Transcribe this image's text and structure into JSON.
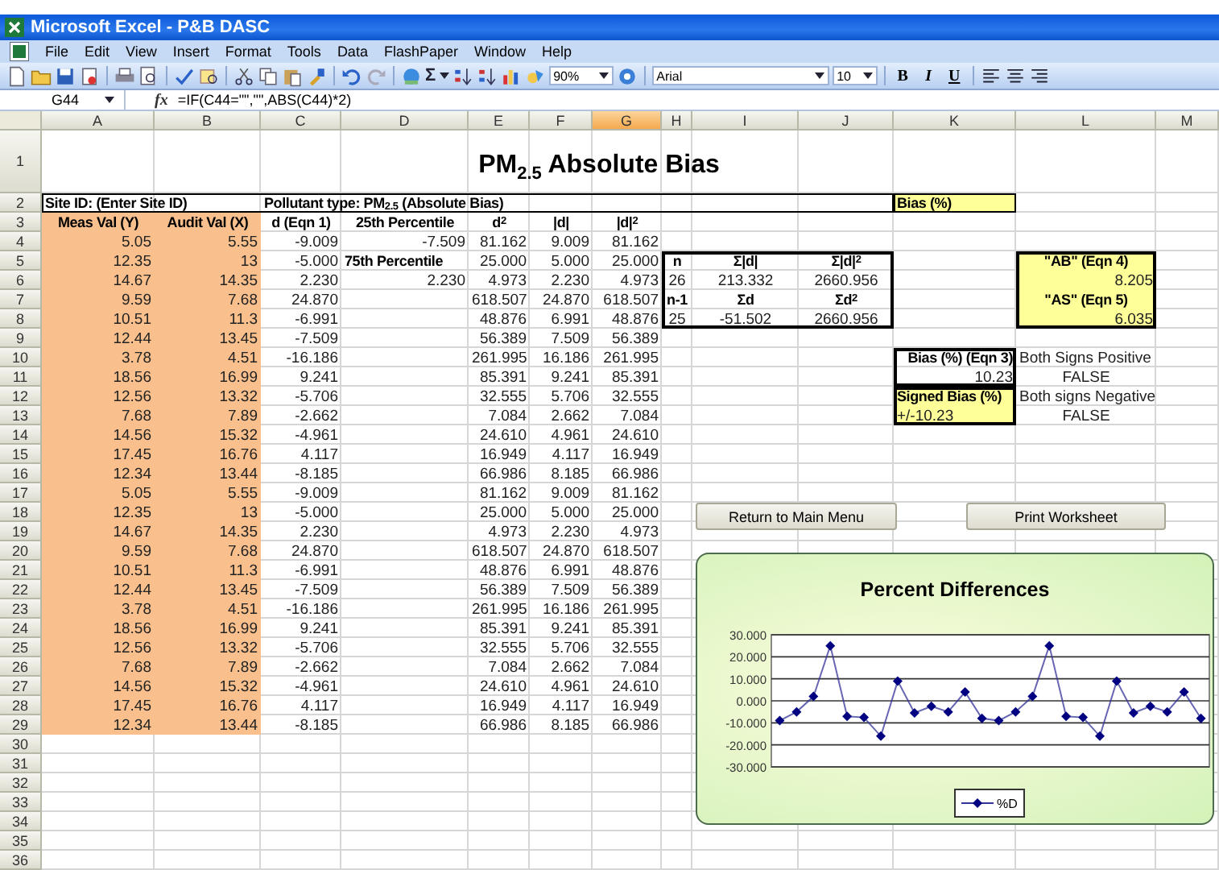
{
  "window": {
    "title": "Microsoft Excel - P&B DASC"
  },
  "menu": [
    "File",
    "Edit",
    "View",
    "Insert",
    "Format",
    "Tools",
    "Data",
    "FlashPaper",
    "Window",
    "Help"
  ],
  "toolbar": {
    "autosum": "Σ",
    "zoom": "90%",
    "font": "Arial",
    "font_size": "10",
    "format_buttons": [
      "B",
      "I",
      "U"
    ]
  },
  "formula_bar": {
    "name_box": "G44",
    "function_label": "fx",
    "formula": "=IF(C44=\"\",\"\",ABS(C44)*2)"
  },
  "columns": [
    {
      "label": "A",
      "selected": false
    },
    {
      "label": "B",
      "selected": false
    },
    {
      "label": "C",
      "selected": false
    },
    {
      "label": "D",
      "selected": false
    },
    {
      "label": "E",
      "selected": false
    },
    {
      "label": "F",
      "selected": false
    },
    {
      "label": "G",
      "selected": true
    },
    {
      "label": "H",
      "selected": false
    },
    {
      "label": "I",
      "selected": false
    },
    {
      "label": "J",
      "selected": false
    },
    {
      "label": "K",
      "selected": false
    },
    {
      "label": "L",
      "selected": false
    },
    {
      "label": "M",
      "selected": false
    }
  ],
  "rows": [
    {
      "number": "1",
      "cells": {
        "A": "PM$_{2.5}$ Absolute Bias"
      }
    },
    {
      "number": "2",
      "cells": {
        "A": "Site ID: (Enter Site ID)",
        "C": "Pollutant type: PM$_{2.5}$ (Absolute Bias)",
        "K": "Bias (%)"
      }
    },
    {
      "number": "3",
      "cells": {
        "A": "Meas Val (Y)",
        "B": "Audit Val (X)",
        "C": "d (Eqn 1)",
        "D": "25th Percentile",
        "E": "d$^{2}$",
        "F": "|d|",
        "G": "|d|$^{2}$"
      }
    },
    {
      "number": "4",
      "cells": {
        "A": "5.05",
        "B": "5.55",
        "C": "-9.009",
        "D": "-7.509",
        "E": "81.162",
        "F": "9.009",
        "G": "81.162"
      }
    },
    {
      "number": "5",
      "cells": {
        "A": "12.35",
        "B": "13",
        "C": "-5.000",
        "D": "75th Percentile",
        "E": "25.000",
        "F": "5.000",
        "G": "25.000",
        "H": "n",
        "I": "Σ|d|",
        "J": "Σ|d|$^{2}$",
        "L": "\"AB\" (Eqn 4)"
      }
    },
    {
      "number": "6",
      "cells": {
        "A": "14.67",
        "B": "14.35",
        "C": "2.230",
        "D": "2.230",
        "E": "4.973",
        "F": "2.230",
        "G": "4.973",
        "H": "26",
        "I": "213.332",
        "J": "2660.956",
        "L": "8.205"
      }
    },
    {
      "number": "7",
      "cells": {
        "A": "9.59",
        "B": "7.68",
        "C": "24.870",
        "E": "618.507",
        "F": "24.870",
        "G": "618.507",
        "H": "n-1",
        "I": "Σd",
        "J": "Σd$^{2}$",
        "L": "\"AS\" (Eqn 5)"
      }
    },
    {
      "number": "8",
      "cells": {
        "A": "10.51",
        "B": "11.3",
        "C": "-6.991",
        "E": "48.876",
        "F": "6.991",
        "G": "48.876",
        "H": "25",
        "I": "-51.502",
        "J": "2660.956",
        "L": "6.035"
      }
    },
    {
      "number": "9",
      "cells": {
        "A": "12.44",
        "B": "13.45",
        "C": "-7.509",
        "E": "56.389",
        "F": "7.509",
        "G": "56.389"
      }
    },
    {
      "number": "10",
      "cells": {
        "A": "3.78",
        "B": "4.51",
        "C": "-16.186",
        "E": "261.995",
        "F": "16.186",
        "G": "261.995",
        "K": "Bias (%) (Eqn 3)",
        "L": "Both Signs Positive"
      }
    },
    {
      "number": "11",
      "cells": {
        "A": "18.56",
        "B": "16.99",
        "C": "9.241",
        "E": "85.391",
        "F": "9.241",
        "G": "85.391",
        "K": "10.23",
        "L": "FALSE"
      }
    },
    {
      "number": "12",
      "cells": {
        "A": "12.56",
        "B": "13.32",
        "C": "-5.706",
        "E": "32.555",
        "F": "5.706",
        "G": "32.555",
        "K": "Signed Bias (%)",
        "L": "Both signs Negative"
      }
    },
    {
      "number": "13",
      "cells": {
        "A": "7.68",
        "B": "7.89",
        "C": "-2.662",
        "E": "7.084",
        "F": "2.662",
        "G": "7.084",
        "K": "+/-10.23",
        "L": "FALSE"
      }
    },
    {
      "number": "14",
      "cells": {
        "A": "14.56",
        "B": "15.32",
        "C": "-4.961",
        "E": "24.610",
        "F": "4.961",
        "G": "24.610"
      }
    },
    {
      "number": "15",
      "cells": {
        "A": "17.45",
        "B": "16.76",
        "C": "4.117",
        "E": "16.949",
        "F": "4.117",
        "G": "16.949"
      }
    },
    {
      "number": "16",
      "cells": {
        "A": "12.34",
        "B": "13.44",
        "C": "-8.185",
        "E": "66.986",
        "F": "8.185",
        "G": "66.986"
      }
    },
    {
      "number": "17",
      "cells": {
        "A": "5.05",
        "B": "5.55",
        "C": "-9.009",
        "E": "81.162",
        "F": "9.009",
        "G": "81.162"
      }
    },
    {
      "number": "18",
      "cells": {
        "A": "12.35",
        "B": "13",
        "C": "-5.000",
        "E": "25.000",
        "F": "5.000",
        "G": "25.000"
      }
    },
    {
      "number": "19",
      "cells": {
        "A": "14.67",
        "B": "14.35",
        "C": "2.230",
        "E": "4.973",
        "F": "2.230",
        "G": "4.973"
      }
    },
    {
      "number": "20",
      "cells": {
        "A": "9.59",
        "B": "7.68",
        "C": "24.870",
        "E": "618.507",
        "F": "24.870",
        "G": "618.507"
      }
    },
    {
      "number": "21",
      "cells": {
        "A": "10.51",
        "B": "11.3",
        "C": "-6.991",
        "E": "48.876",
        "F": "6.991",
        "G": "48.876"
      }
    },
    {
      "number": "22",
      "cells": {
        "A": "12.44",
        "B": "13.45",
        "C": "-7.509",
        "E": "56.389",
        "F": "7.509",
        "G": "56.389"
      }
    },
    {
      "number": "23",
      "cells": {
        "A": "3.78",
        "B": "4.51",
        "C": "-16.186",
        "E": "261.995",
        "F": "16.186",
        "G": "261.995"
      }
    },
    {
      "number": "24",
      "cells": {
        "A": "18.56",
        "B": "16.99",
        "C": "9.241",
        "E": "85.391",
        "F": "9.241",
        "G": "85.391"
      }
    },
    {
      "number": "25",
      "cells": {
        "A": "12.56",
        "B": "13.32",
        "C": "-5.706",
        "E": "32.555",
        "F": "5.706",
        "G": "32.555"
      }
    },
    {
      "number": "26",
      "cells": {
        "A": "7.68",
        "B": "7.89",
        "C": "-2.662",
        "E": "7.084",
        "F": "2.662",
        "G": "7.084"
      }
    },
    {
      "number": "27",
      "cells": {
        "A": "14.56",
        "B": "15.32",
        "C": "-4.961",
        "E": "24.610",
        "F": "4.961",
        "G": "24.610"
      }
    },
    {
      "number": "28",
      "cells": {
        "A": "17.45",
        "B": "16.76",
        "C": "4.117",
        "E": "16.949",
        "F": "4.117",
        "G": "16.949"
      }
    },
    {
      "number": "29",
      "cells": {
        "A": "12.34",
        "B": "13.44",
        "C": "-8.185",
        "E": "66.986",
        "F": "8.185",
        "G": "66.986"
      }
    },
    {
      "number": "30",
      "cells": {}
    },
    {
      "number": "31",
      "cells": {}
    },
    {
      "number": "32",
      "cells": {}
    },
    {
      "number": "33",
      "cells": {}
    },
    {
      "number": "34",
      "cells": {}
    },
    {
      "number": "35",
      "cells": {}
    },
    {
      "number": "36",
      "cells": {}
    }
  ],
  "buttons": [
    "Return to Main Menu",
    "Print Worksheet"
  ],
  "chart": {
    "chart_data": {
      "type": "line",
      "title": "Percent Differences",
      "grid": true,
      "ylim": [
        -30,
        30
      ],
      "yticks": [
        {
          "value": 30,
          "label": "30.000"
        },
        {
          "value": 20,
          "label": "20.000"
        },
        {
          "value": 10,
          "label": "10.000"
        },
        {
          "value": 0,
          "label": "0.000"
        },
        {
          "value": -10,
          "label": "-10.000"
        },
        {
          "value": -20,
          "label": "-20.000"
        },
        {
          "value": -30,
          "label": "-30.000"
        }
      ],
      "series": [
        {
          "name": "%D",
          "color": "#333399",
          "marker": "diamond",
          "values": [
            -9,
            -5,
            2,
            25,
            -7,
            -7.5,
            -16,
            9,
            -5.5,
            -2.5,
            -5,
            4,
            -8,
            -9,
            -5,
            2,
            25,
            -7,
            -7.5,
            -16,
            9,
            -5.5,
            -2.5,
            -5,
            4,
            -8
          ]
        }
      ]
    }
  }
}
